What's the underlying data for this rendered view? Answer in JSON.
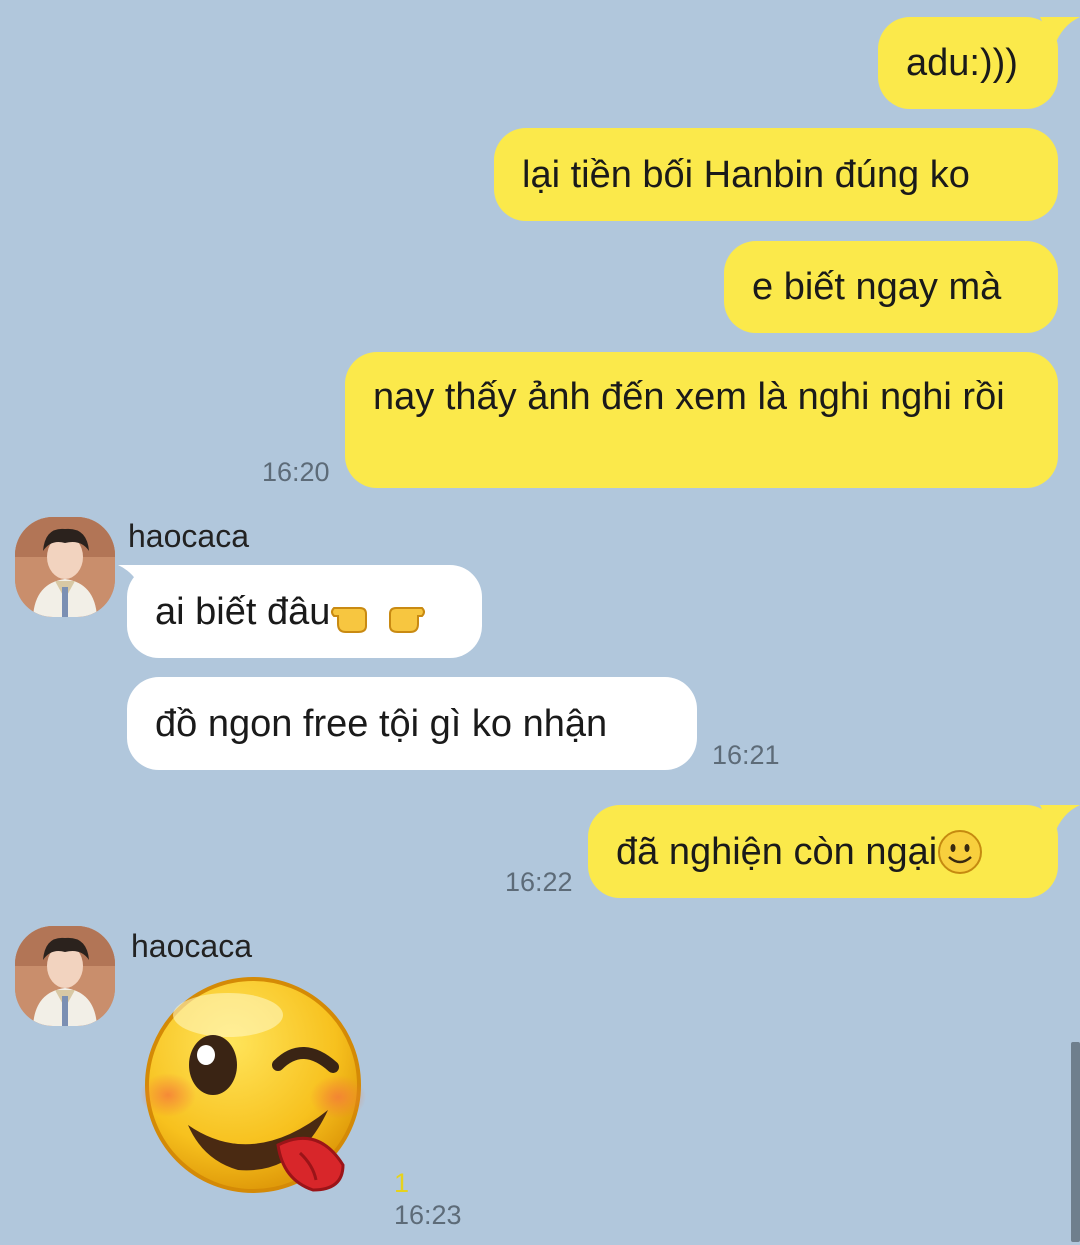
{
  "chat": {
    "background": "#b1c7dc",
    "outgoing_color": "#fbe94b",
    "incoming_color": "#ffffff",
    "messages": [
      {
        "id": "m1",
        "direction": "out",
        "text": "adu:)))"
      },
      {
        "id": "m2",
        "direction": "out",
        "text": "lại tiền bối Hanbin đúng ko"
      },
      {
        "id": "m3",
        "direction": "out",
        "text": "e biết ngay mà"
      },
      {
        "id": "m4",
        "direction": "out",
        "text": "nay thấy ảnh đến xem là nghi nghi rồi",
        "time": "16:20"
      },
      {
        "id": "m5",
        "direction": "in",
        "sender": "haocaca",
        "text": "ai biết đâu",
        "emoji": "pointing-hands-emoji"
      },
      {
        "id": "m6",
        "direction": "in",
        "text": "đồ ngon free tội gì ko nhận",
        "time": "16:21"
      },
      {
        "id": "m7",
        "direction": "out",
        "text": "đã nghiện còn ngại",
        "emoji": "smile-emoji",
        "time": "16:22"
      },
      {
        "id": "m8",
        "direction": "in",
        "sender": "haocaca",
        "sticker": "wink-tongue-emoji-sticker",
        "unread": "1",
        "time": "16:23"
      }
    ]
  }
}
